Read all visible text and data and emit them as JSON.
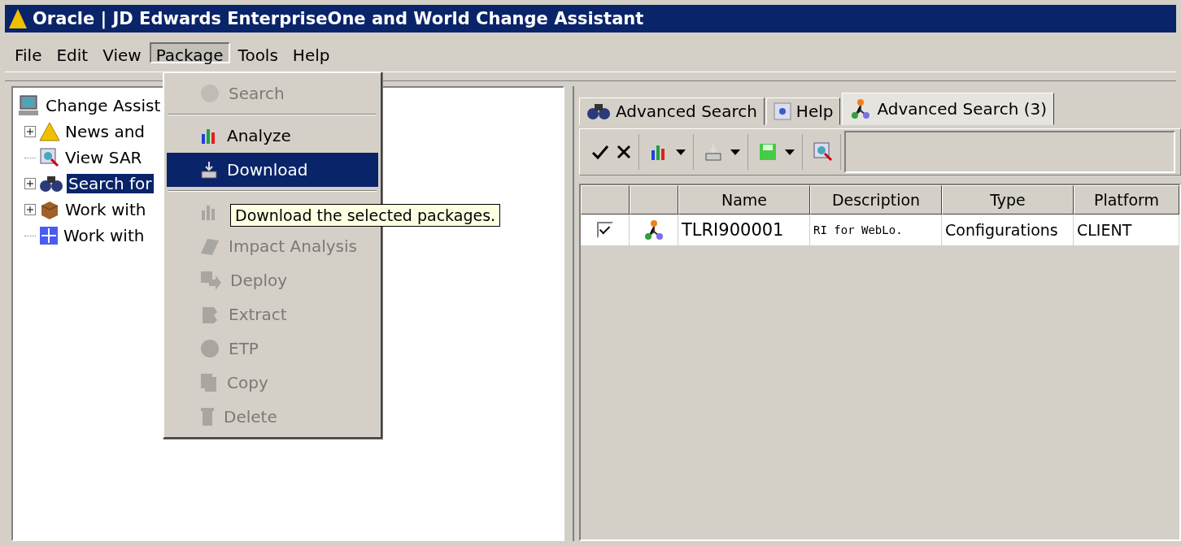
{
  "window": {
    "title": "Oracle | JD Edwards EnterpriseOne and World Change Assistant"
  },
  "menu_bar": [
    {
      "label": "File",
      "selected": false
    },
    {
      "label": "Edit",
      "selected": false
    },
    {
      "label": "View",
      "selected": false
    },
    {
      "label": "Package",
      "selected": true
    },
    {
      "label": "Tools",
      "selected": false
    },
    {
      "label": "Help",
      "selected": false
    }
  ],
  "tree": {
    "label": "Change Assist",
    "children": [
      {
        "label": "News and",
        "kind": "folder",
        "selected": false
      },
      {
        "label": "View SAR",
        "kind": "leaf",
        "selected": false
      },
      {
        "label": "Search for",
        "kind": "folder",
        "selected": true
      },
      {
        "label": "Work with",
        "kind": "folder",
        "selected": false
      },
      {
        "label": "Work with",
        "kind": "leaf",
        "selected": false
      }
    ]
  },
  "package_menu": [
    {
      "kind": "item",
      "label": "Search",
      "disabled": true,
      "selected": false
    },
    {
      "kind": "separator"
    },
    {
      "kind": "item",
      "label": "Analyze",
      "disabled": false,
      "selected": false
    },
    {
      "kind": "item",
      "label": "Download",
      "disabled": false,
      "selected": true
    },
    {
      "kind": "separator"
    },
    {
      "kind": "item",
      "disabled": true,
      "selected": false
    },
    {
      "kind": "item",
      "label": "Impact Analysis",
      "disabled": true,
      "selected": false
    },
    {
      "kind": "item",
      "label": "Deploy",
      "disabled": true,
      "selected": false
    },
    {
      "kind": "item",
      "label": "Extract",
      "disabled": true,
      "selected": false
    },
    {
      "kind": "item",
      "label": "ETP",
      "disabled": true,
      "selected": false
    },
    {
      "kind": "item",
      "label": "Copy",
      "disabled": true,
      "selected": false
    },
    {
      "kind": "item",
      "label": "Delete",
      "disabled": true,
      "selected": false
    }
  ],
  "tooltip": "Download the selected packages.",
  "tabs": [
    {
      "label": "Advanced Search",
      "selected": false
    },
    {
      "label": "Help",
      "selected": false
    },
    {
      "label": "Advanced Search (3)",
      "selected": true
    }
  ],
  "table": {
    "columns": [
      "Name",
      "Description",
      "Type",
      "Platform"
    ],
    "rows": [
      {
        "checked": true,
        "name": "TLRI900001",
        "description": "RI for WebLo.",
        "type": "Configurations",
        "platform": "CLIENT"
      }
    ]
  }
}
